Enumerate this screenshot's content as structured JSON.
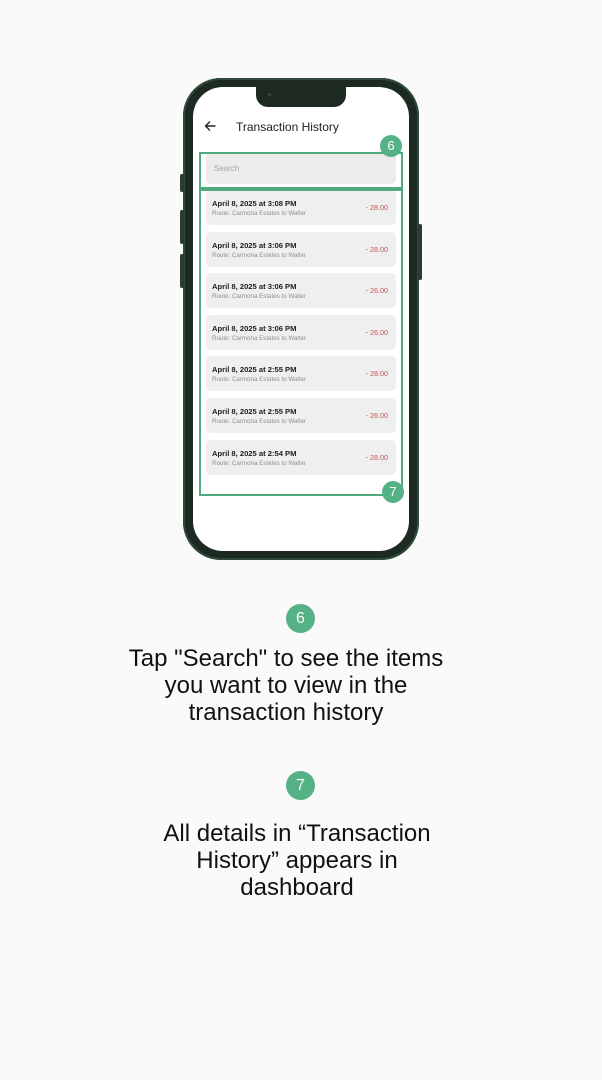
{
  "app": {
    "title": "Transaction History",
    "back_icon": "arrow-left-icon"
  },
  "search": {
    "placeholder": "Search",
    "value": ""
  },
  "transactions": [
    {
      "date": "April 8, 2025 at 3:08 PM",
      "route": "Route: Carmona Estates to Walter",
      "amount": "- 28.00"
    },
    {
      "date": "April 8, 2025 at 3:06 PM",
      "route": "Route: Carmona Estates to Walter",
      "amount": "- 28.00"
    },
    {
      "date": "April 8, 2025 at 3:06 PM",
      "route": "Route: Carmona Estates to Walter",
      "amount": "- 26.00"
    },
    {
      "date": "April 8, 2025 at 3:06 PM",
      "route": "Route: Carmona Estates to Walter",
      "amount": "- 26.00"
    },
    {
      "date": "April 8, 2025 at 2:55 PM",
      "route": "Route: Carmona Estates to Walter",
      "amount": "- 28.00"
    },
    {
      "date": "April 8, 2025 at 2:55 PM",
      "route": "Route: Carmona Estates to Walter",
      "amount": "- 26.00"
    },
    {
      "date": "April 8, 2025 at 2:54 PM",
      "route": "Route: Carmona Estates to Walter",
      "amount": "- 28.00"
    }
  ],
  "annotations": {
    "search_marker": "6",
    "list_marker": "7"
  },
  "steps": [
    {
      "number": "6",
      "text": "Tap \"Search\" to see the items\nyou want to view in the\ntransaction history"
    },
    {
      "number": "7",
      "text": "All details in “Transaction\nHistory” appears in\ndashboard"
    }
  ],
  "colors": {
    "accent": "#55b287",
    "highlight_border": "#4faa7d",
    "amount": "#c0564e",
    "phone_frame": "#1d2a22"
  }
}
